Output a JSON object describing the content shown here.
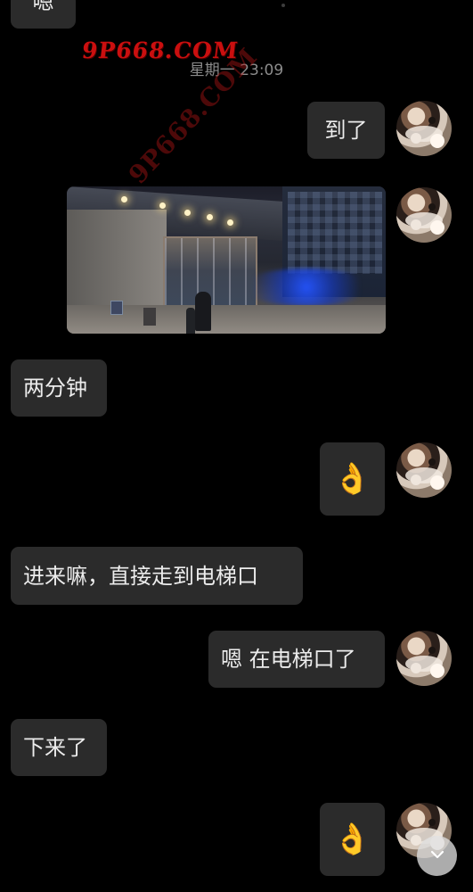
{
  "chat": {
    "timestamp": "星期一 23:09",
    "watermark": "9P668.COM",
    "diagonal_watermark": "9P668.COM",
    "messages": [
      {
        "id": "msg-top",
        "side": "left",
        "type": "text",
        "text": "嗯"
      },
      {
        "id": "msg-1",
        "side": "right",
        "type": "text",
        "text": "到了"
      },
      {
        "id": "msg-2",
        "side": "right",
        "type": "image"
      },
      {
        "id": "msg-3",
        "side": "left",
        "type": "text",
        "text": "两分钟"
      },
      {
        "id": "msg-4",
        "side": "right",
        "type": "emoji",
        "text": "👌"
      },
      {
        "id": "msg-5",
        "side": "left",
        "type": "text",
        "text": "进来嘛，直接走到电梯口"
      },
      {
        "id": "msg-6",
        "side": "right",
        "type": "text",
        "text": "嗯 在电梯口了"
      },
      {
        "id": "msg-7",
        "side": "left",
        "type": "text",
        "text": "下来了"
      },
      {
        "id": "msg-8",
        "side": "right",
        "type": "emoji",
        "text": "👌"
      }
    ]
  },
  "icons": {
    "scroll_down": "chevron-down-icon"
  },
  "colors": {
    "background": "#000000",
    "bubble": "#2b2b2b",
    "text": "#ececec",
    "timestamp": "#8c8c8c",
    "watermark": "#d51010"
  }
}
